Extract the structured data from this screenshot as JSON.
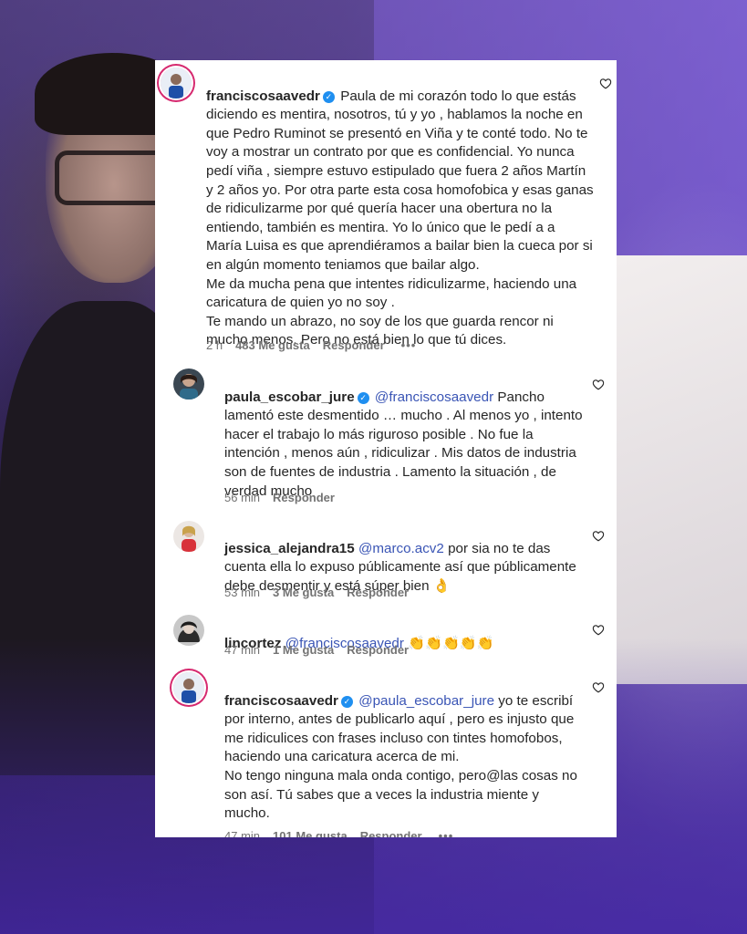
{
  "comments": [
    {
      "username": "franciscosaavedr",
      "text": "Paula de mi corazón todo lo que estás diciendo es mentira, nosotros, tú y yo , hablamos la noche en que Pedro Ruminot se presentó en Viña y te conté todo. No te voy a mostrar un contrato por que es confidencial. Yo nunca pedí viña , siempre estuvo estipulado que fuera 2 años Martín y 2 años yo. Por otra parte esta cosa homofobica y esas ganas de ridiculizarme por qué quería hacer una obertura no la entiendo, también es mentira. Yo lo único que le pedí a a María Luisa es que aprendiéramos a bailar bien la cueca por si en algún momento teniamos que bailar algo.\nMe da mucha pena que intentes ridiculizarme, haciendo una caricatura de quien yo no soy .\nTe mando un abrazo, no soy de los que guarda rencor ni mucho menos. Pero no está bien lo que tú dices.",
      "time": "2 h",
      "likes": "483 Me gusta",
      "reply": "Responder",
      "more": "•••"
    },
    {
      "username": "paula_escobar_jure",
      "mention": "@franciscosaavedr",
      "text": "Pancho lamentó este desmentido … mucho . Al menos yo , intento hacer el trabajo lo más riguroso posible . No fue la intención , menos aún , ridiculizar . Mis datos de industria son de fuentes de industria . Lamento la situación , de verdad mucho",
      "time": "56 min",
      "reply": "Responder"
    },
    {
      "username": "jessica_alejandra15",
      "mention": "@marco.acv2",
      "text": "por sia no te das cuenta ella lo expuso públicamente así que públicamente debe desmentir y está súper bien 👌",
      "time": "53 min",
      "likes": "3 Me gusta",
      "reply": "Responder"
    },
    {
      "username": "lincortez",
      "mention": "@franciscosaavedr",
      "text": "👏👏👏👏👏",
      "time": "47 min",
      "likes": "1 Me gusta",
      "reply": "Responder"
    },
    {
      "username": "franciscosaavedr",
      "mention": "@paula_escobar_jure",
      "text": "yo te escribí por interno, antes de publicarlo aquí , pero es injusto que me ridiculices con frases incluso con tintes homofobos, haciendo una caricatura acerca de mi.\nNo tengo ninguna mala onda contigo, pero@las cosas no son así. Tú sabes que a veces la industria miente y mucho.",
      "time": "47 min",
      "likes": "101 Me gusta",
      "reply": "Responder",
      "more": "•••"
    }
  ],
  "icons": {
    "verified": "verified-badge-icon",
    "like": "heart-outline-icon",
    "more": "more-dots-icon"
  },
  "colors": {
    "mention": "#3a55b5",
    "verified": "#1f8ff0",
    "meta": "#737373",
    "background_purple": "#5b3fb0"
  }
}
